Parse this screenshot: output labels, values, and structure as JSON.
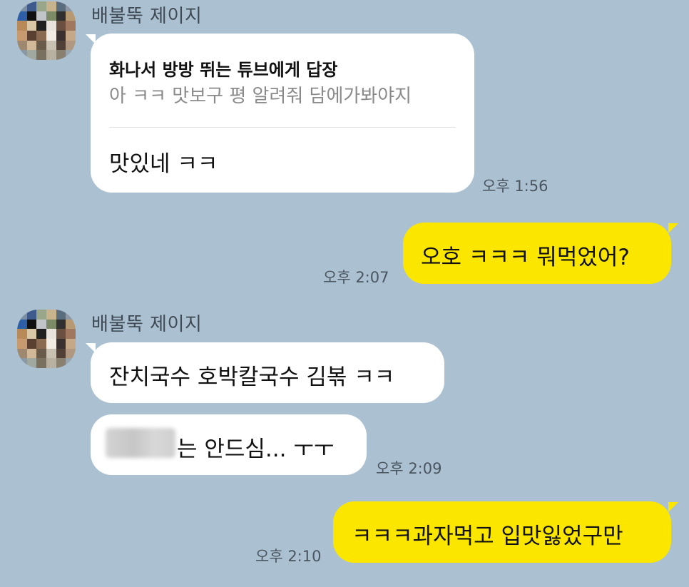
{
  "messages": [
    {
      "sender": "배불뚝 제이지",
      "reply": {
        "header": "화나서 방방 뛰는 튜브에게 답장",
        "quote": "아 ㅋㅋ 맛보구 평 알려줘 담에가봐야지"
      },
      "text": "맛있네 ㅋㅋ",
      "time": "오후 1:56"
    },
    {
      "text": "오호 ㅋㅋㅋ 뭐먹었어?",
      "time": "오후 2:07"
    },
    {
      "sender": "배불뚝 제이지",
      "text": "잔치국수 호박칼국수 김볶 ㅋㅋ"
    },
    {
      "text": "는 안드심... ㅜㅜ",
      "time": "오후 2:09"
    },
    {
      "text": "ㅋㅋㅋ과자먹고 입맛잃었구만",
      "time": "오후 2:10"
    }
  ],
  "colors": {
    "background": "#abc1d1",
    "outgoing_bubble": "#fbe600",
    "incoming_bubble": "#ffffff"
  },
  "avatar_icon": "pixelated-profile-icon"
}
